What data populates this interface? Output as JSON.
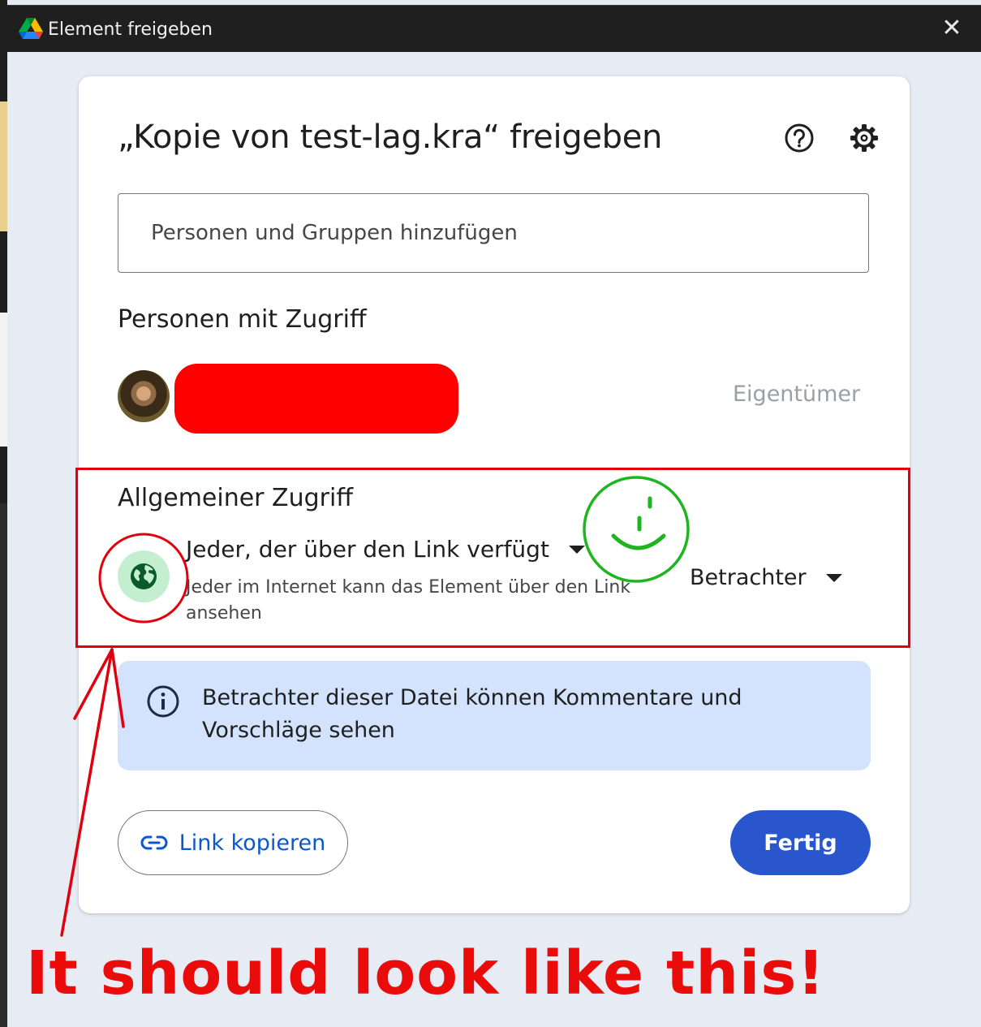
{
  "window": {
    "title": "Element freigeben",
    "close_icon": "close-icon",
    "app_icon": "google-drive-icon"
  },
  "dialog": {
    "title": "„Kopie von test-lag.kra“ freigeben",
    "help_icon": "help-icon",
    "settings_icon": "gear-icon",
    "add_people_placeholder": "Personen und Gruppen hinzufügen",
    "people_with_access": {
      "heading": "Personen mit Zugriff",
      "entries": [
        {
          "name": "",
          "role": "Eigentümer",
          "redacted": true
        }
      ]
    },
    "general_access": {
      "heading": "Allgemeiner Zugriff",
      "icon": "globe-icon",
      "scope": "Jeder, der über den Link verfügt",
      "description": "Jeder im Internet kann das Element über den Link ansehen",
      "role": "Betrachter"
    },
    "info": {
      "icon": "info-icon",
      "text": "Betrachter dieser Datei können Kommentare und Vorschläge sehen"
    },
    "buttons": {
      "copy_link": "Link kopieren",
      "copy_link_icon": "link-icon",
      "done": "Fertig"
    }
  },
  "annotations": {
    "caption": "It should look like this!",
    "colors": {
      "red": "#e0000e",
      "green": "#1fb51f"
    }
  },
  "colors": {
    "primary": "#2956cc",
    "link_text": "#0b57d0",
    "info_bg": "#d3e3fd",
    "globe_bg": "#c4eed0"
  }
}
